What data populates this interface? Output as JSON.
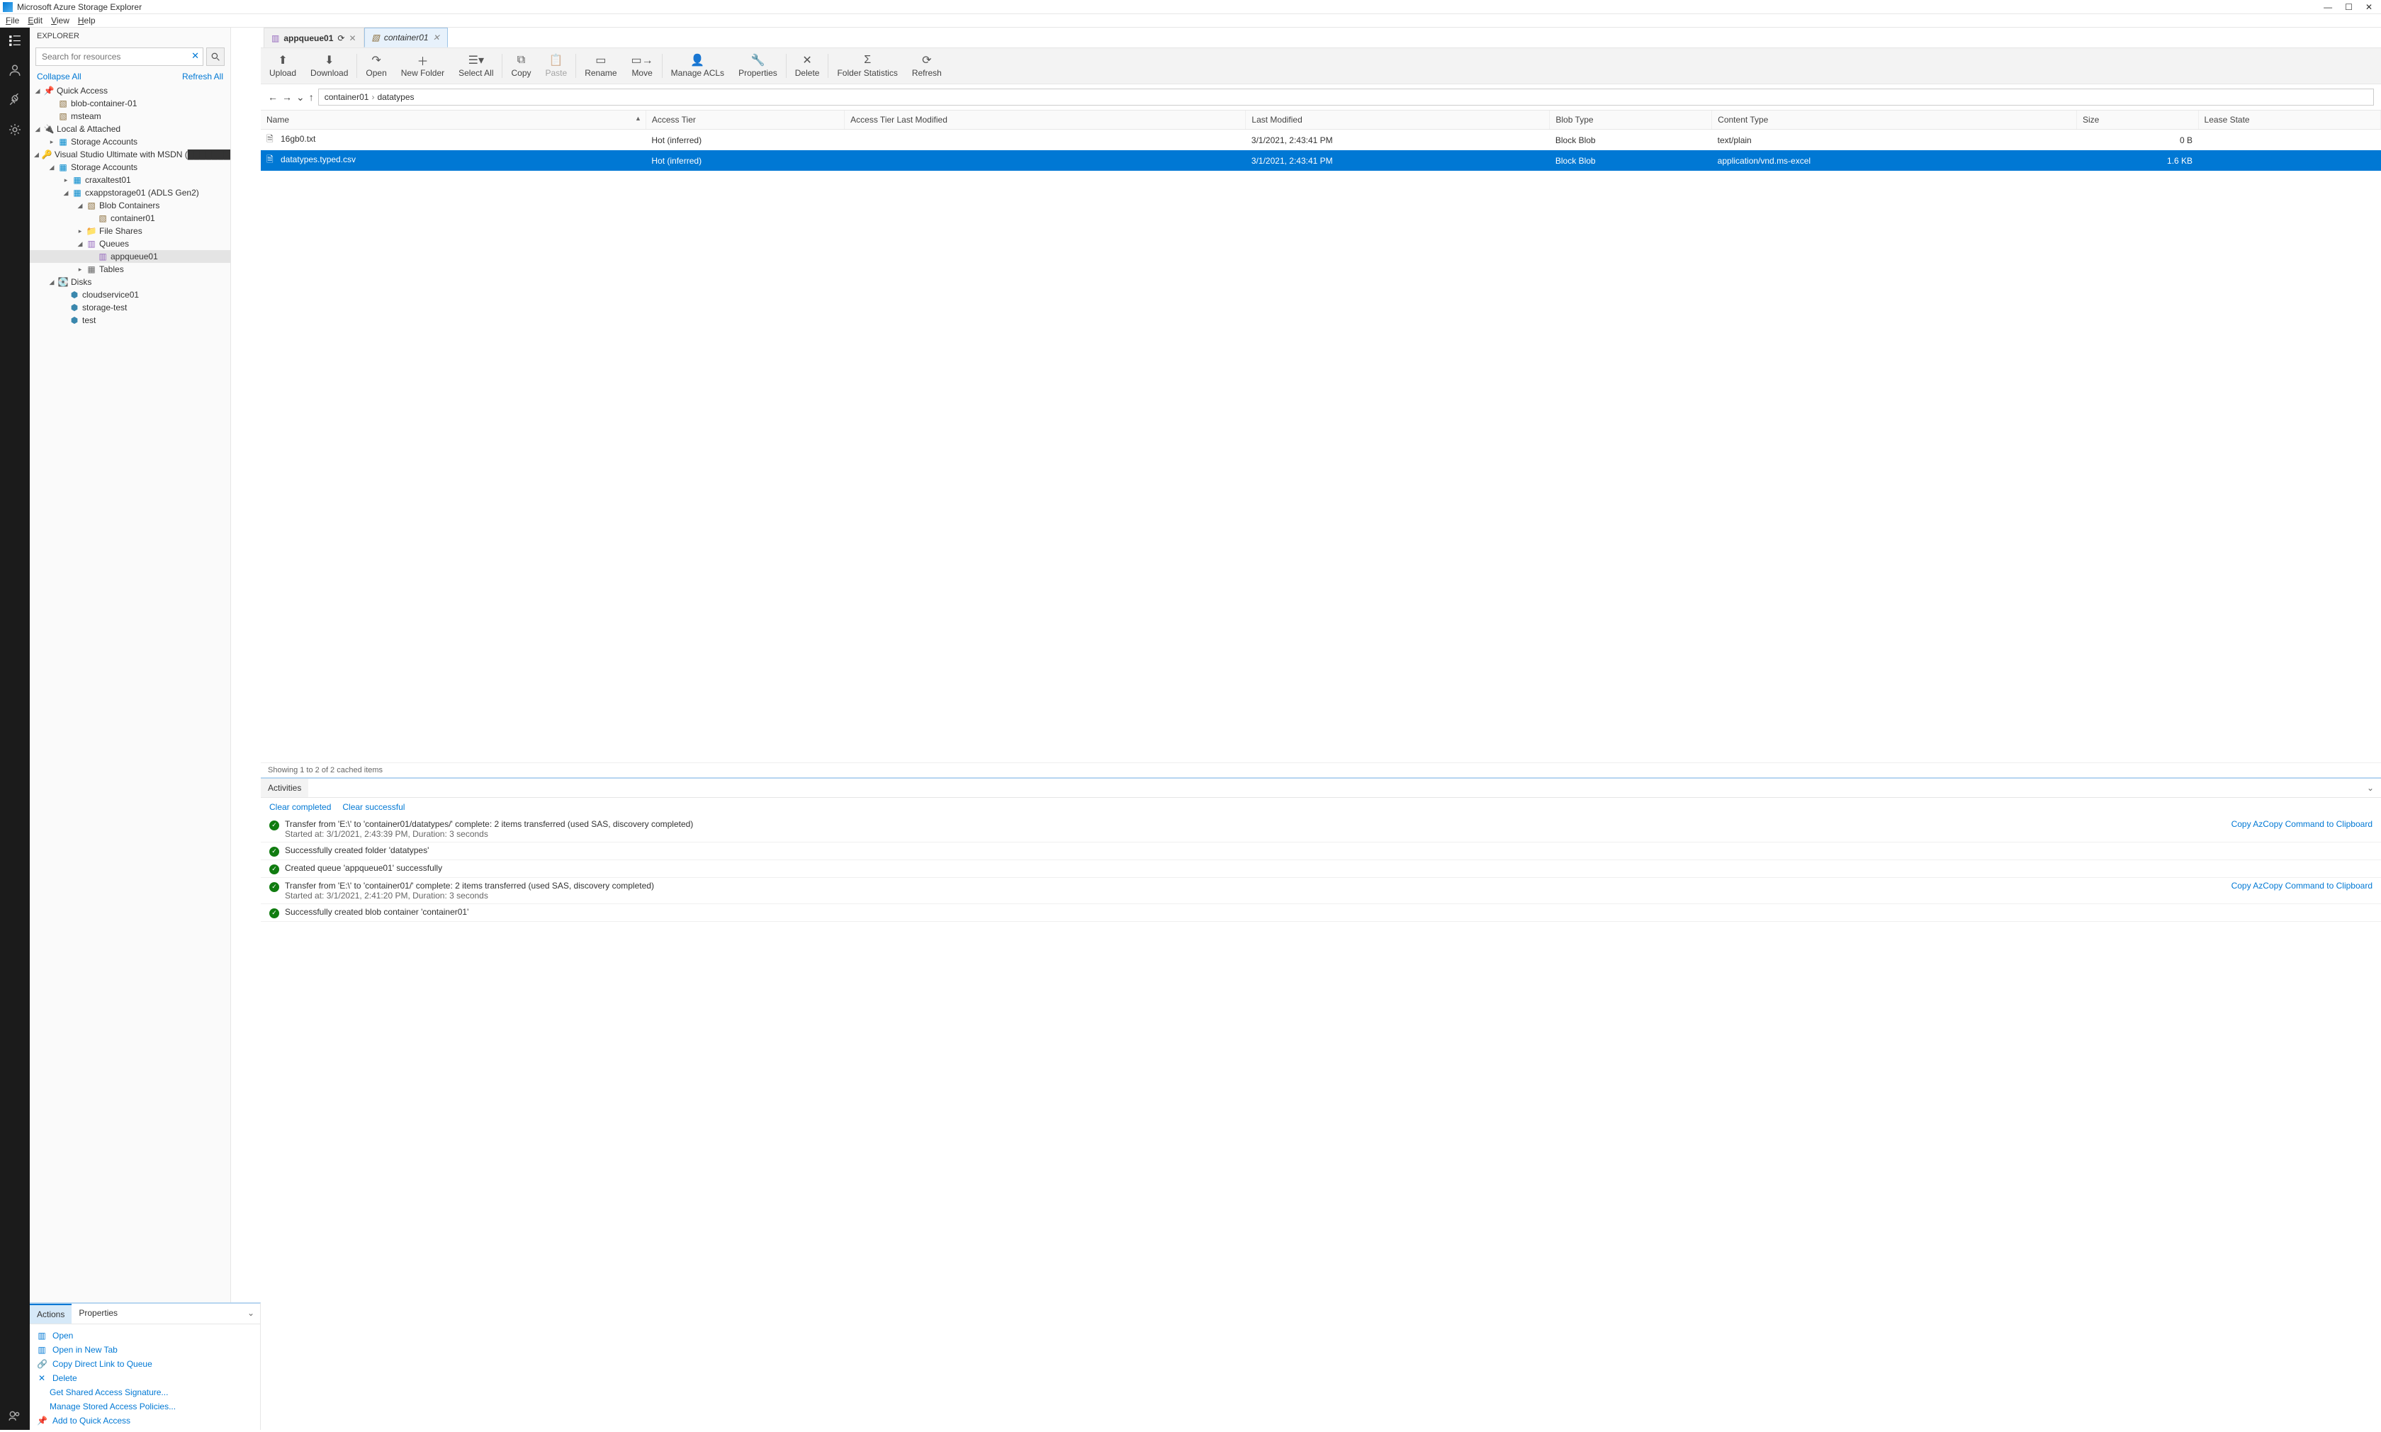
{
  "titlebar": {
    "title": "Microsoft Azure Storage Explorer"
  },
  "menubar": [
    "File",
    "Edit",
    "View",
    "Help"
  ],
  "explorer": {
    "header": "EXPLORER",
    "search_placeholder": "Search for resources",
    "collapse_all": "Collapse All",
    "refresh_all": "Refresh All",
    "tree": {
      "quick_access": "Quick Access",
      "qa_items": [
        "blob-container-01",
        "msteam"
      ],
      "local_attached": "Local & Attached",
      "la_storage": "Storage Accounts",
      "subscription": "Visual Studio Ultimate with MSDN (",
      "subscription_tail": ")",
      "sa_label": "Storage Accounts",
      "sa_items": {
        "craxaltest01": "craxaltest01",
        "cxappstorage01": "cxappstorage01 (ADLS Gen2)",
        "blob_containers": "Blob Containers",
        "container01": "container01",
        "file_shares": "File Shares",
        "queues": "Queues",
        "appqueue01": "appqueue01",
        "tables": "Tables"
      },
      "disks": "Disks",
      "disk_items": [
        "cloudservice01",
        "storage-test",
        "test"
      ]
    }
  },
  "tabs": [
    {
      "label": "appqueue01",
      "type": "queue",
      "active": false,
      "loading": true
    },
    {
      "label": "container01",
      "type": "container",
      "active": true
    }
  ],
  "toolbar": [
    {
      "label": "Upload",
      "disabled": false
    },
    {
      "label": "Download",
      "disabled": false
    },
    {
      "sep": true
    },
    {
      "label": "Open",
      "disabled": false
    },
    {
      "label": "New Folder",
      "disabled": false
    },
    {
      "label": "Select All",
      "disabled": false
    },
    {
      "sep": true
    },
    {
      "label": "Copy",
      "disabled": false
    },
    {
      "label": "Paste",
      "disabled": true
    },
    {
      "sep": true
    },
    {
      "label": "Rename",
      "disabled": false
    },
    {
      "label": "Move",
      "disabled": false
    },
    {
      "sep": true
    },
    {
      "label": "Manage ACLs",
      "disabled": false
    },
    {
      "label": "Properties",
      "disabled": false
    },
    {
      "sep": true
    },
    {
      "label": "Delete",
      "disabled": false
    },
    {
      "sep": true
    },
    {
      "label": "Folder Statistics",
      "disabled": false
    },
    {
      "label": "Refresh",
      "disabled": false
    }
  ],
  "breadcrumb": [
    "container01",
    "datatypes"
  ],
  "columns": [
    "Name",
    "Access Tier",
    "Access Tier Last Modified",
    "Last Modified",
    "Blob Type",
    "Content Type",
    "Size",
    "Lease State"
  ],
  "rows": [
    {
      "name": "16gb0.txt",
      "tier": "Hot (inferred)",
      "tier_mod": "",
      "mod": "3/1/2021, 2:43:41 PM",
      "blob_type": "Block Blob",
      "content_type": "text/plain",
      "size": "0 B",
      "lease": "",
      "selected": false
    },
    {
      "name": "datatypes.typed.csv",
      "tier": "Hot (inferred)",
      "tier_mod": "",
      "mod": "3/1/2021, 2:43:41 PM",
      "blob_type": "Block Blob",
      "content_type": "application/vnd.ms-excel",
      "size": "1.6 KB",
      "lease": "",
      "selected": true
    }
  ],
  "status": "Showing 1 to 2 of 2 cached items",
  "actions_panel": {
    "tabs": [
      "Actions",
      "Properties"
    ],
    "active_tab": 0,
    "items": [
      {
        "icon": "queue",
        "label": "Open"
      },
      {
        "icon": "queue",
        "label": "Open in New Tab"
      },
      {
        "icon": "link",
        "label": "Copy Direct Link to Queue"
      },
      {
        "icon": "delete",
        "label": "Delete"
      },
      {
        "icon": "none",
        "label": "Get Shared Access Signature..."
      },
      {
        "icon": "none",
        "label": "Manage Stored Access Policies..."
      },
      {
        "icon": "pin",
        "label": "Add to Quick Access"
      }
    ]
  },
  "activities": {
    "header": "Activities",
    "clear_completed": "Clear completed",
    "clear_successful": "Clear successful",
    "copy_link": "Copy AzCopy Command to Clipboard",
    "items": [
      {
        "line1": "Transfer from 'E:\\' to 'container01/datatypes/' complete: 2 items transferred (used SAS, discovery completed)",
        "line2": "Started at: 3/1/2021, 2:43:39 PM, Duration: 3 seconds",
        "has_copy": true
      },
      {
        "line1": "Successfully created folder 'datatypes'",
        "line2": "",
        "has_copy": false
      },
      {
        "line1": "Created queue 'appqueue01' successfully",
        "line2": "",
        "has_copy": false
      },
      {
        "line1": "Transfer from 'E:\\' to 'container01/' complete: 2 items transferred (used SAS, discovery completed)",
        "line2": "Started at: 3/1/2021, 2:41:20 PM, Duration: 3 seconds",
        "has_copy": true
      },
      {
        "line1": "Successfully created blob container 'container01'",
        "line2": "",
        "has_copy": false
      }
    ]
  }
}
